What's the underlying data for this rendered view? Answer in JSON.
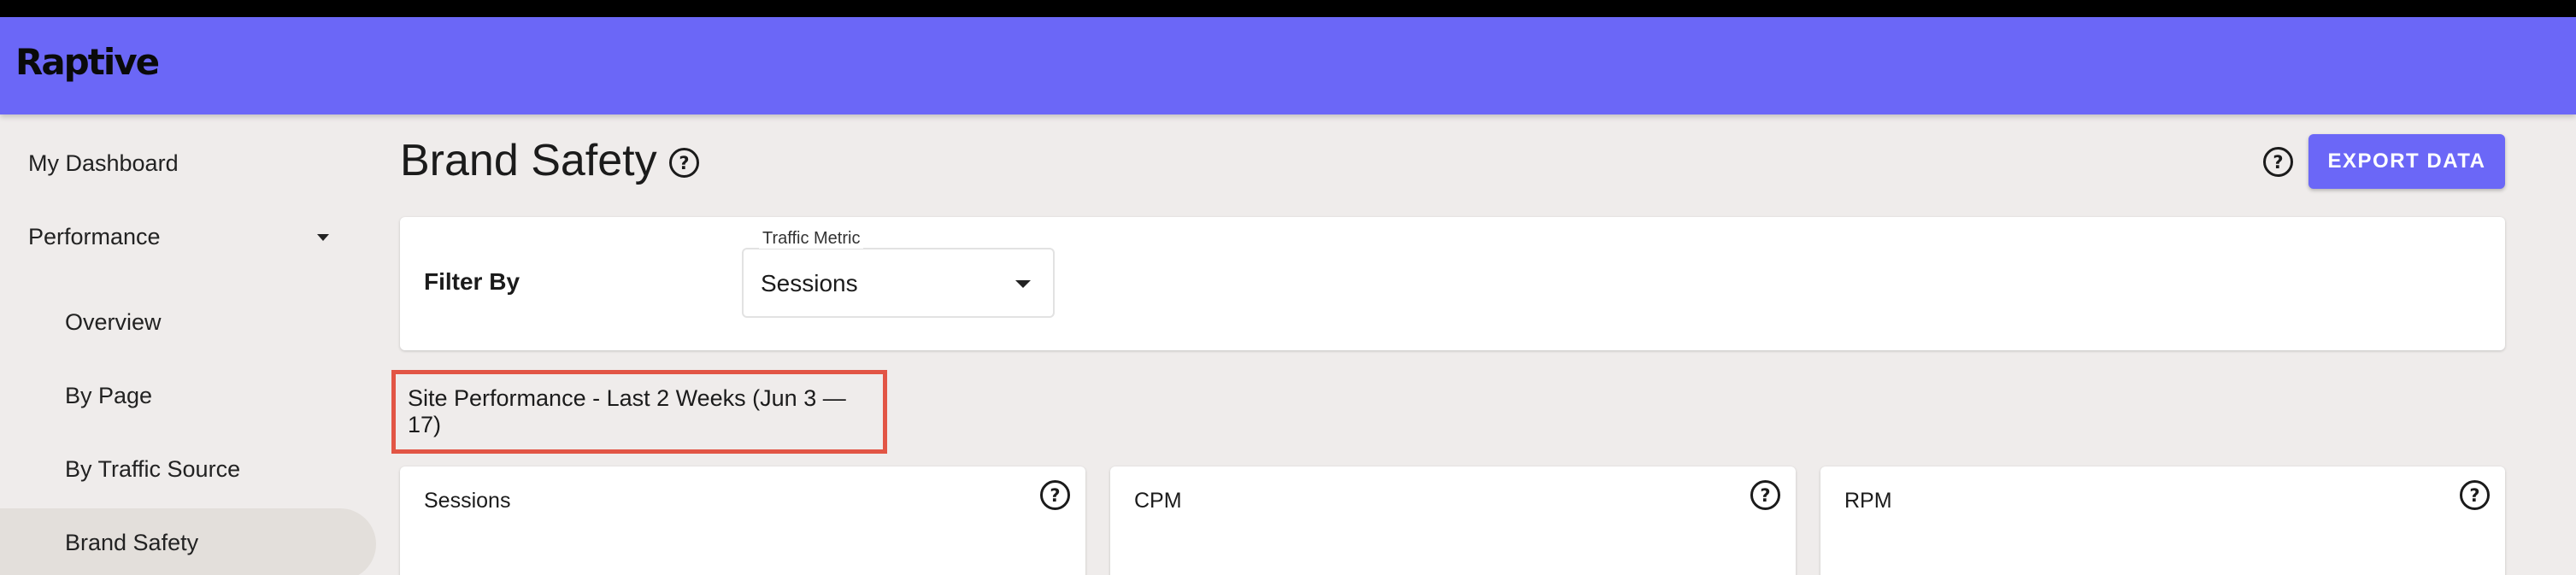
{
  "app": {
    "logo": "Raptive",
    "accent_color": "#6b67f7"
  },
  "sidebar": {
    "items": [
      {
        "label": "My Dashboard"
      },
      {
        "label": "Performance",
        "icon": "caret-down-icon"
      },
      {
        "label": "Overview"
      },
      {
        "label": "By Page"
      },
      {
        "label": "By Traffic Source"
      },
      {
        "label": "Brand Safety",
        "active": true
      }
    ]
  },
  "header": {
    "title": "Brand Safety",
    "title_icon": "help-circle-icon",
    "help_icon": "help-circle-icon",
    "export_label": "EXPORT DATA"
  },
  "filter": {
    "label": "Filter By",
    "traffic_metric": {
      "label": "Traffic Metric",
      "value": "Sessions"
    }
  },
  "section": {
    "heading": "Site Performance - Last 2 Weeks (Jun 3 — 17)",
    "highlight_color": "#e25545"
  },
  "metrics": [
    {
      "title": "Sessions",
      "icon": "help-circle-icon"
    },
    {
      "title": "CPM",
      "icon": "help-circle-icon"
    },
    {
      "title": "RPM",
      "icon": "help-circle-icon"
    }
  ]
}
